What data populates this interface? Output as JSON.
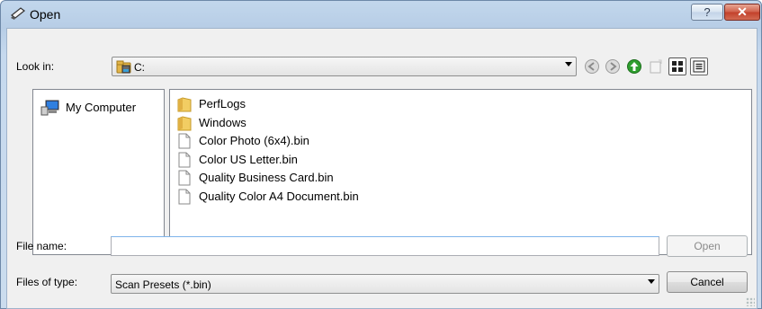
{
  "window": {
    "title": "Open",
    "title_icon": "scanner-icon",
    "help_label": "?",
    "close_label": "✕"
  },
  "lookin": {
    "label": "Look in:",
    "value": "C:",
    "icon": "drive-icon"
  },
  "toolbar": {
    "icons": [
      "back-icon",
      "forward-icon",
      "up-folder-icon",
      "new-folder-icon",
      "list-view-icon",
      "details-view-icon"
    ]
  },
  "places": {
    "items": [
      {
        "label": "My Computer",
        "icon": "computer-icon"
      }
    ]
  },
  "files": [
    {
      "name": "PerfLogs",
      "type": "folder"
    },
    {
      "name": "Windows",
      "type": "folder"
    },
    {
      "name": "Color Photo (6x4).bin",
      "type": "file"
    },
    {
      "name": "Color US Letter.bin",
      "type": "file"
    },
    {
      "name": "Quality Business Card.bin",
      "type": "file"
    },
    {
      "name": "Quality Color A4 Document.bin",
      "type": "file"
    }
  ],
  "filename": {
    "label": "File name:",
    "value": "",
    "placeholder": ""
  },
  "filetype": {
    "label": "Files of type:",
    "value": "Scan Presets (*.bin)"
  },
  "buttons": {
    "open": "Open",
    "cancel": "Cancel"
  },
  "colors": {
    "titlebar": "#c2d7ec",
    "close": "#c2402a",
    "folder": "#e8c15a",
    "nav_green": "#2e9e2e"
  }
}
